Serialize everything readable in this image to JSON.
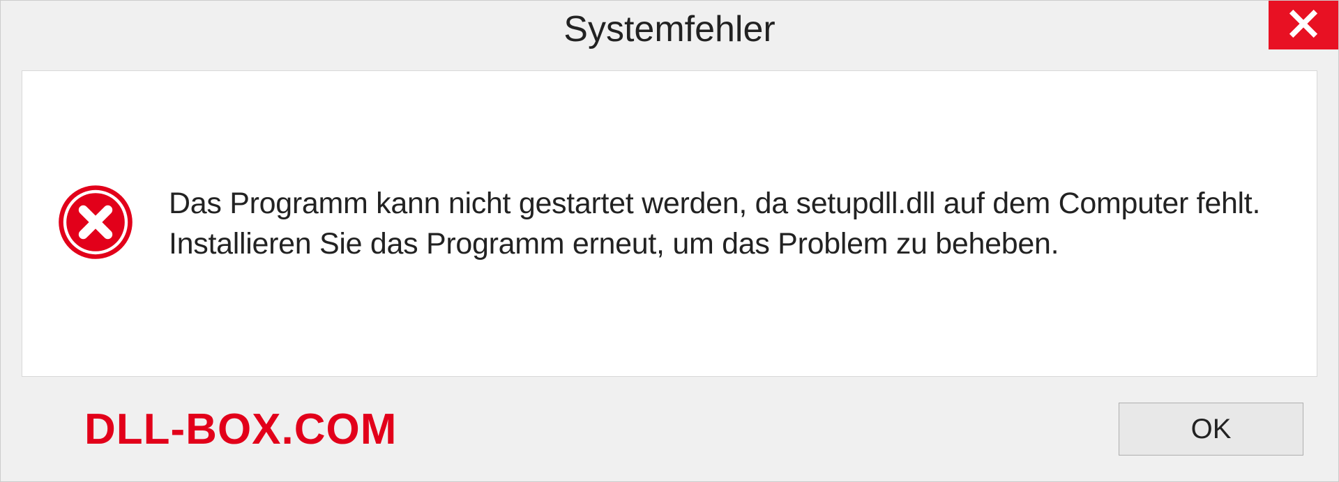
{
  "dialog": {
    "title": "Systemfehler",
    "message": "Das Programm kann nicht gestartet werden, da setupdll.dll auf dem Computer fehlt. Installieren Sie das Programm erneut, um das Problem zu beheben.",
    "ok_label": "OK"
  },
  "watermark": "DLL-BOX.COM"
}
